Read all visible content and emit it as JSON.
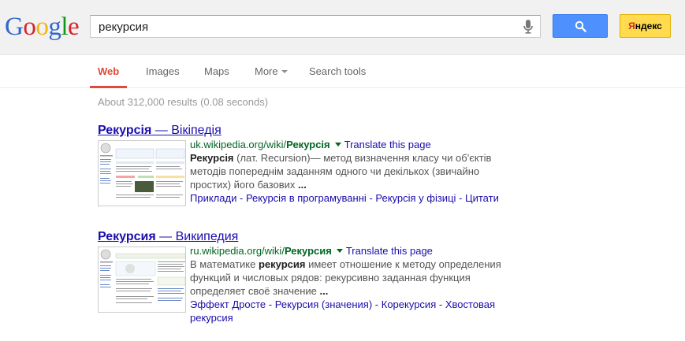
{
  "header": {
    "logo_text": "Google",
    "search_value": "рекурсия",
    "yandex_label_part1": "Я",
    "yandex_label_part2": "ндекс"
  },
  "nav": {
    "tabs": [
      "Web",
      "Images",
      "Maps",
      "More",
      "Search tools"
    ]
  },
  "stats": "About 312,000 results (0.08 seconds)",
  "results": [
    {
      "title_bold": "Рекурсія",
      "title_rest": " — Вікіпедія",
      "url_base": "uk.wikipedia.org/wiki/",
      "url_bold": "Рекурсія",
      "translate": "Translate this page",
      "snippet_bold": "Рекурсія",
      "snippet_rest": " (лат. Recursion)— метод визначення класу чи об'єктів методів попереднім заданням одного чи декількох (звичайно простих) його базових ",
      "snippet_ellipsis": "...",
      "sitelinks": [
        "Приклади",
        "Рекурсія в програмуванні",
        "Рекурсія у фізиці",
        "Цитати"
      ]
    },
    {
      "title_bold": "Рекурсия",
      "title_rest": " — Википедия",
      "url_base": "ru.wikipedia.org/wiki/",
      "url_bold": "Рекурсия",
      "translate": "Translate this page",
      "snippet_pre": "В математике ",
      "snippet_bold": "рекурсия",
      "snippet_rest": " имеет отношение к методу определения функций и числовых рядов: рекурсивно заданная функция определяет своё значение ",
      "snippet_ellipsis": "...",
      "sitelinks": [
        "Эффект Дросте",
        "Рекурсия (значения)",
        "Корекурсия",
        "Хвостовая рекурсия"
      ]
    }
  ],
  "colors": {
    "accent_red": "#dd4b39",
    "link_blue": "#1a0dab",
    "url_green": "#006621",
    "search_button": "#4d90fe",
    "yandex_button": "#ffdb4d"
  },
  "icons": {
    "mic": "microphone-icon",
    "search": "magnifier-icon"
  }
}
